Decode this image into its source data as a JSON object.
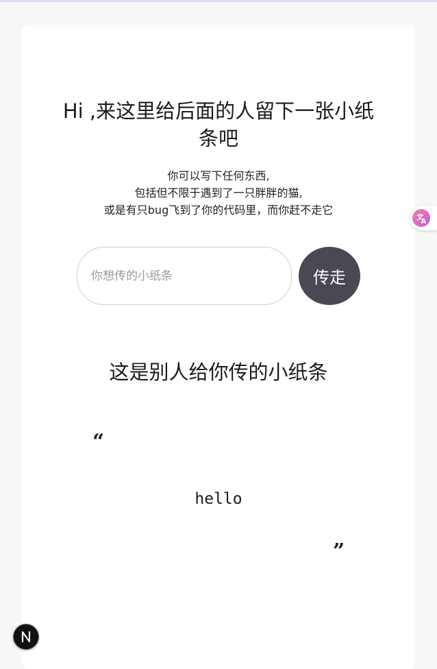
{
  "header": {
    "title": "Hi ,来这里给后面的人留下一张小纸条吧",
    "description_lines": [
      "你可以写下任何东西,",
      "包括但不限于遇到了一只胖胖的猫,",
      "或是有只bug飞到了你的代码里，而你赶不走它"
    ]
  },
  "form": {
    "input_placeholder": "你想传的小纸条",
    "input_value": "",
    "submit_label": "传走"
  },
  "received": {
    "section_title": "这是别人给你传的小纸条",
    "open_quote": "“",
    "message": "hello",
    "close_quote": "”"
  },
  "widgets": {
    "translate_icon": "translate-icon",
    "next_logo_icon": "nextjs-logo-icon"
  },
  "colors": {
    "button_bg": "#494953",
    "page_bg": "#f7f7f8",
    "card_bg": "#ffffff"
  }
}
